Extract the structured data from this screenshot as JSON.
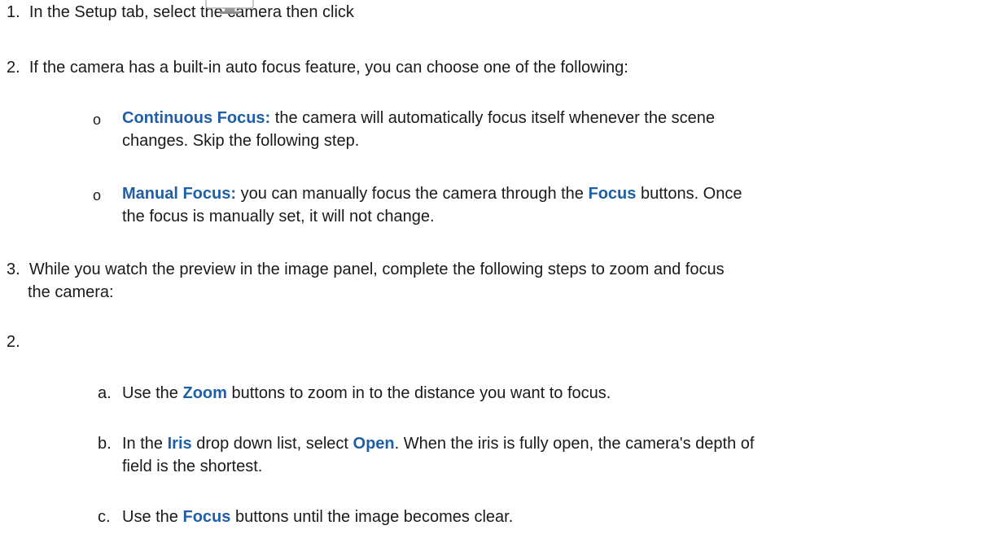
{
  "steps": {
    "s1": {
      "num": "1.",
      "before_icon": "In the Setup tab, select the camera then click",
      "after_icon": ".",
      "icon": "monitor-icon"
    },
    "s2": {
      "num": "2.",
      "text": "If the camera has a built-in auto focus feature, you can choose one of the following:"
    },
    "opt_cont": {
      "bullet": "o",
      "term": "Continuous Focus:",
      "text1": " the camera will automatically focus itself whenever the scene",
      "text2": "changes. Skip the following step."
    },
    "opt_man": {
      "bullet": "o",
      "term": "Manual Focus:",
      "text1a": " you can manually focus the camera through the ",
      "term2": "Focus",
      "text1b": " buttons. Once",
      "text2": "the focus is manually set, it will not change."
    },
    "s3": {
      "num": "3.",
      "text1": "While you watch the preview in the image panel, complete the following steps to zoom and focus",
      "text2": "the camera:"
    },
    "s2b": {
      "num": "2."
    },
    "sub_a": {
      "letter": "a.",
      "pre": "Use the ",
      "term": "Zoom",
      "post": " buttons to zoom in to the distance you want to focus."
    },
    "sub_b": {
      "letter": "b.",
      "pre": "In the ",
      "term1": "Iris",
      "mid": " drop down list, select ",
      "term2": "Open",
      "post": ". When the iris is fully open, the camera's depth of",
      "text2": "field is the shortest."
    },
    "sub_c": {
      "letter": "c.",
      "pre": "Use the ",
      "term": "Focus",
      "post": " buttons until the image becomes clear."
    }
  },
  "colors": {
    "highlight": "#1f5fa8",
    "text": "#1a1a1a"
  }
}
